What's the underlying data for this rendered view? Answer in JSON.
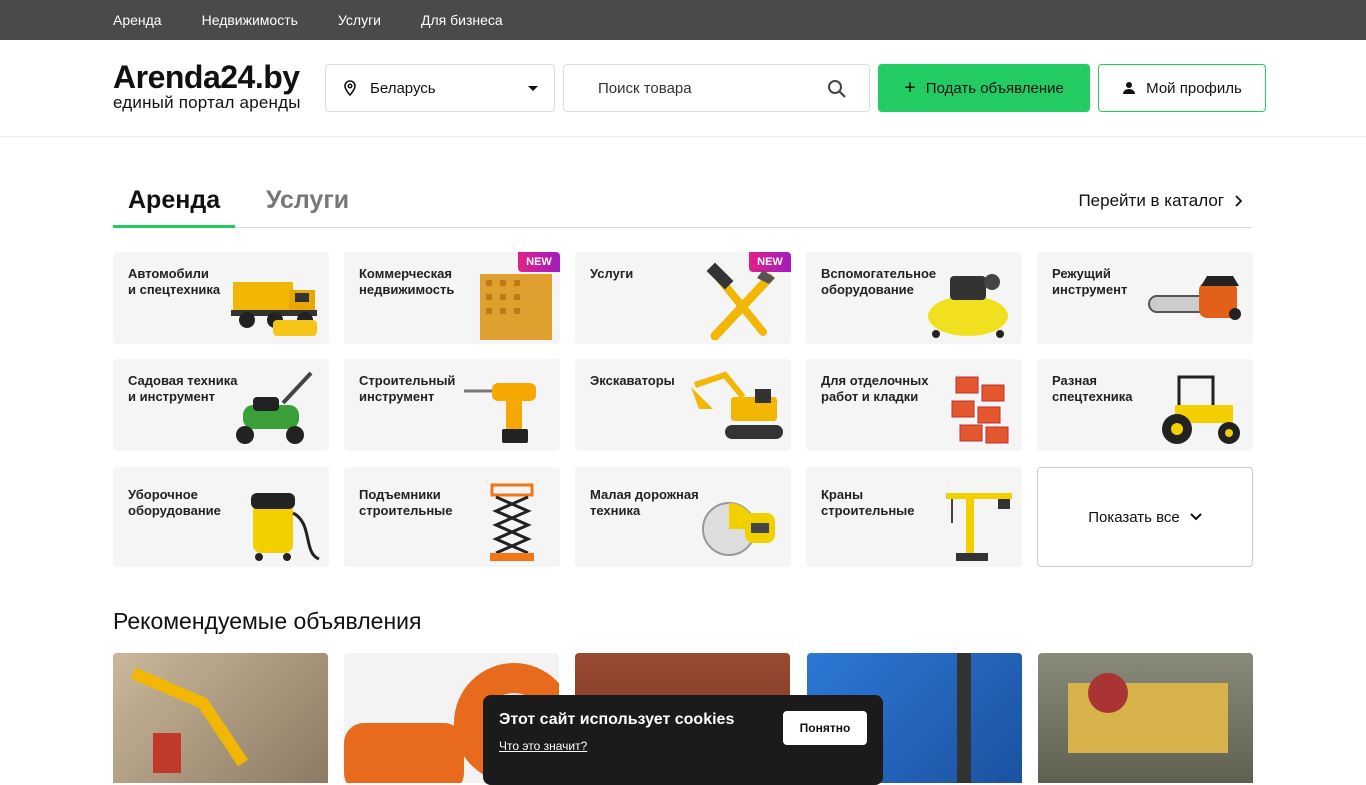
{
  "topnav": [
    "Аренда",
    "Недвижимость",
    "Услуги",
    "Для бизнеса"
  ],
  "logo": {
    "name": "Arenda24.by",
    "tagline": "единый портал аренды"
  },
  "region": {
    "value": "Беларусь"
  },
  "search": {
    "placeholder": "Поиск товара"
  },
  "buttons": {
    "post_ad": "Подать объявление",
    "profile": "Мой профиль"
  },
  "tabs": {
    "active": "Аренда",
    "inactive": "Услуги",
    "catalog": "Перейти в каталог"
  },
  "categories": [
    {
      "label": "Автомобили\nи спецтехника",
      "new": false
    },
    {
      "label": "Коммерческая\nнедвижимость",
      "new": true
    },
    {
      "label": "Услуги",
      "new": true
    },
    {
      "label": "Вспомогательное\nоборудование",
      "new": false
    },
    {
      "label": "Режущий\nинструмент",
      "new": false
    },
    {
      "label": "Садовая техника\nи инструмент",
      "new": false
    },
    {
      "label": "Строительный\nинструмент",
      "new": false
    },
    {
      "label": "Экскаваторы",
      "new": false
    },
    {
      "label": "Для отделочных\nработ и кладки",
      "new": false
    },
    {
      "label": "Разная\nспецтехника",
      "new": false
    },
    {
      "label": "Уборочное\nоборудование",
      "new": false
    },
    {
      "label": "Подъемники\nстроительные",
      "new": false
    },
    {
      "label": "Малая дорожная\nтехника",
      "new": false
    },
    {
      "label": "Краны\nстроительные",
      "new": false
    }
  ],
  "badge_new": "NEW",
  "show_all": "Показать все",
  "recommended_title": "Рекомендуемые объявления",
  "cookie": {
    "title": "Этот сайт использует cookies",
    "link": "Что это значит?",
    "button": "Понятно"
  },
  "colors": {
    "accent": "#22cc63",
    "topbar": "#4a4a4a",
    "card_bg": "#f5f5f5"
  }
}
